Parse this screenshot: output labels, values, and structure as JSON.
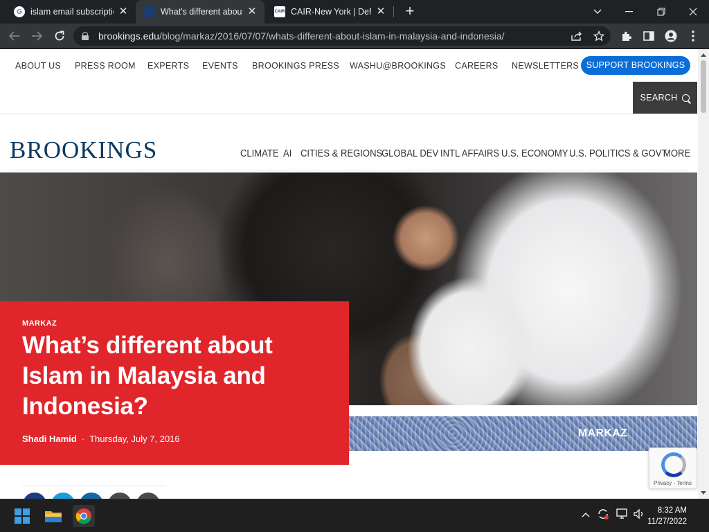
{
  "browser": {
    "tabs": [
      {
        "title": "islam email subscription",
        "favicon": "google-icon",
        "active": false
      },
      {
        "title": "What's different about",
        "favicon": "brookings-icon",
        "active": true
      },
      {
        "title": "CAIR-New York | Defen",
        "favicon": "cair-icon",
        "active": false
      }
    ],
    "url_host": "brookings.edu",
    "url_path": "/blog/markaz/2016/07/07/whats-different-about-islam-in-malaysia-and-indonesia/"
  },
  "site": {
    "utility_nav": [
      "ABOUT US",
      "PRESS ROOM",
      "EXPERTS",
      "EVENTS",
      "BROOKINGS PRESS",
      "WASHU@BROOKINGS",
      "CAREERS",
      "NEWSLETTERS"
    ],
    "support_label": "SUPPORT BROOKINGS",
    "search_label": "SEARCH",
    "logo": "BROOKINGS",
    "main_nav": [
      "CLIMATE",
      "AI",
      "CITIES & REGIONS",
      "GLOBAL DEV",
      "INTL AFFAIRS",
      "U.S. ECONOMY",
      "U.S. POLITICS & GOVT",
      "MORE"
    ]
  },
  "article": {
    "kicker": "MARKAZ",
    "headline": "What’s different about Islam in Malaysia and Indonesia?",
    "author": "Shadi Hamid",
    "separator": "·",
    "date": "Thursday, July 7, 2016",
    "banner_label": "MARKAZ"
  },
  "recaptcha": {
    "text": "Privacy - Terms"
  },
  "taskbar": {
    "time": "8:32 AM",
    "date": "11/27/2022"
  },
  "colors": {
    "brand_red": "#e0262b",
    "brand_blue": "#0b6ed8",
    "logo_navy": "#0a3a63"
  }
}
